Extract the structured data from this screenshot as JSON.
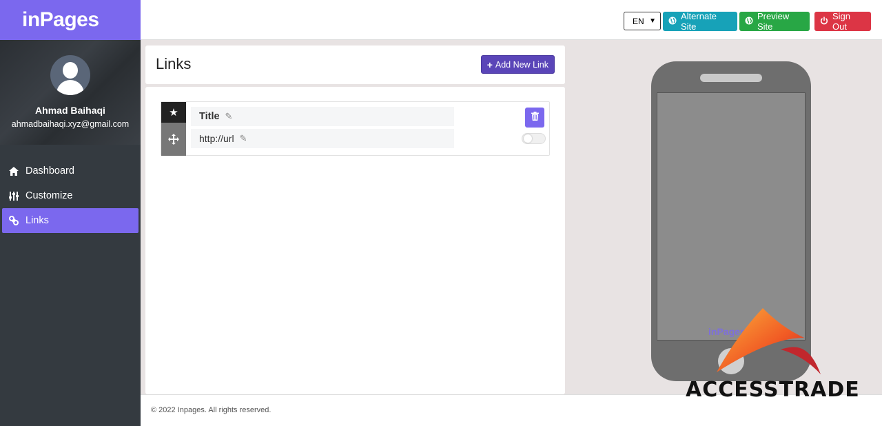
{
  "brand": {
    "name": "inPages"
  },
  "user": {
    "name": "Ahmad Baihaqi",
    "email": "ahmadbaihaqi.xyz@gmail.com"
  },
  "sidebar": {
    "items": [
      {
        "label": "Dashboard",
        "icon": "home-icon",
        "active": false
      },
      {
        "label": "Customize",
        "icon": "sliders-icon",
        "active": false
      },
      {
        "label": "Links",
        "icon": "link-icon",
        "active": true
      }
    ]
  },
  "topbar": {
    "language": "EN",
    "alternate_label": "Alternate Site",
    "preview_label": "Preview Site",
    "signout_label": "Sign Out"
  },
  "colors": {
    "accent": "#7b68ee",
    "sidebar": "#343a40",
    "info": "#17a2b8",
    "success": "#28a745",
    "danger": "#dc3545"
  },
  "page": {
    "title": "Links",
    "add_label": "Add New Link"
  },
  "links": [
    {
      "title": "Title",
      "url": "http://url",
      "enabled": false
    }
  ],
  "footer": {
    "text": "© 2022 Inpages. All rights reserved."
  },
  "preview": {
    "screen_brand": "inPages"
  },
  "watermark": {
    "text": "ACCESSTRADE"
  }
}
